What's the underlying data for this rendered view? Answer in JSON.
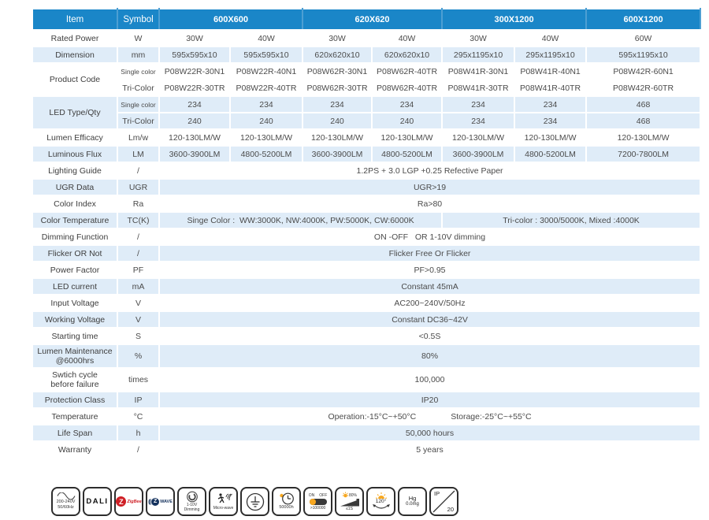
{
  "spec": {
    "header": {
      "item": "Item",
      "symbol": "Symbol",
      "sizes": [
        "600X600",
        "620X620",
        "300X1200",
        "600X1200"
      ]
    },
    "rated_power": {
      "label": "Rated Power",
      "unit": "W",
      "values": [
        "30W",
        "40W",
        "30W",
        "40W",
        "30W",
        "40W",
        "60W"
      ]
    },
    "dimension": {
      "label": "Dimension",
      "unit": "mm",
      "values": [
        "595x595x10",
        "595x595x10",
        "620x620x10",
        "620x620x10",
        "295x1195x10",
        "295x1195x10",
        "595x1195x10"
      ]
    },
    "product_code": {
      "label": "Product Code",
      "single_label": "Single color",
      "tri_label": "Tri-Color",
      "single": [
        "P08W22R-30N1",
        "P08W22R-40N1",
        "P08W62R-30N1",
        "P08W62R-40TR",
        "P08W41R-30N1",
        "P08W41R-40N1",
        "P08W42R-60N1"
      ],
      "tri": [
        "P08W22R-30TR",
        "P08W22R-40TR",
        "P08W62R-30TR",
        "P08W62R-40TR",
        "P08W41R-30TR",
        "P08W41R-40TR",
        "P08W42R-60TR"
      ]
    },
    "led_qty": {
      "label": "LED Type/Qty",
      "single_label": "Single color",
      "tri_label": "Tri-Color",
      "single": [
        "234",
        "234",
        "234",
        "234",
        "234",
        "234",
        "468"
      ],
      "tri": [
        "240",
        "240",
        "240",
        "240",
        "234",
        "234",
        "468"
      ]
    },
    "lumen_efficacy": {
      "label": "Lumen Efficacy",
      "unit": "Lm/w",
      "values": [
        "120-130LM/W",
        "120-130LM/W",
        "120-130LM/W",
        "120-130LM/W",
        "120-130LM/W",
        "120-130LM/W",
        "120-130LM/W"
      ]
    },
    "luminous_flux": {
      "label": "Luminous Flux",
      "unit": "LM",
      "values": [
        "3600-3900LM",
        "4800-5200LM",
        "3600-3900LM",
        "4800-5200LM",
        "3600-3900LM",
        "4800-5200LM",
        "7200-7800LM"
      ]
    },
    "lighting_guide": {
      "label": "Lighting Guide",
      "unit": "/",
      "value": "1.2PS + 3.0 LGP +0.25 Refective Paper"
    },
    "ugr": {
      "label": "UGR  Data",
      "unit": "UGR",
      "value": "UGR>19"
    },
    "color_index": {
      "label": "Color Index",
      "unit": "Ra",
      "value": "Ra>80"
    },
    "color_temp": {
      "label": "Color Temperature",
      "unit": "TC(K)",
      "single": "Singe Color :  WW:3000K, NW:4000K, PW:5000K, CW:6000K",
      "tri": "Tri-color : 3000/5000K, Mixed :4000K"
    },
    "dimming": {
      "label": "Dimming Function",
      "unit": "/",
      "value": "ON -OFF   OR 1-10V dimming"
    },
    "flicker": {
      "label": "Flicker OR Not",
      "unit": "/",
      "value": "Flicker Free Or Flicker"
    },
    "power_factor": {
      "label": "Power Factor",
      "unit": "PF",
      "value": "PF>0.95"
    },
    "led_current": {
      "label": "LED current",
      "unit": "mA",
      "value": "Constant 45mA"
    },
    "input_voltage": {
      "label": "Input Voltage",
      "unit": "V",
      "value": "AC200~240V/50Hz"
    },
    "working_voltage": {
      "label": "Working Voltage",
      "unit": "V",
      "value": "Constant DC36~42V"
    },
    "starting_time": {
      "label": "Starting time",
      "unit": "S",
      "value": "<0.5S"
    },
    "lumen_maintenance": {
      "label1": "Lumen Maintenance",
      "label2": "@6000hrs",
      "unit": "%",
      "value": "80%"
    },
    "switch_cycle": {
      "label1": "Swtich cycle",
      "label2": "before failure",
      "unit": "times",
      "value": "100,000"
    },
    "protection": {
      "label": "Protection Class",
      "unit": "IP",
      "value": "IP20"
    },
    "temperature": {
      "label": "Temperature",
      "unit": "°C",
      "operation": "Operation:-15°C~+50°C",
      "storage": "Storage:-25°C~+55°C"
    },
    "life_span": {
      "label": "Life Span",
      "unit": "h",
      "value": "50,000 hours"
    },
    "warranty": {
      "label": "Warranty",
      "unit": "/",
      "value": "5 years"
    }
  },
  "icons": {
    "voltage_line1": "200-240V",
    "voltage_line2": "50/60Hz",
    "dali": "DALI",
    "zigbee_z": "Z",
    "zigbee": "ZigBee",
    "zwave_wave": "((",
    "zwave_z": "Z",
    "zwave_text": "WAVE",
    "dimming_line1": "1-10V",
    "dimming_line2": "Dimming",
    "microwave": "Micro-wave",
    "lifespan": "50000h",
    "switch_on": "ON",
    "switch_off": "OFF",
    "switch_cycles": ">100000",
    "start_pct": "80%",
    "start_time": "≤1S",
    "beam_angle": "120°",
    "hg_line1": "Hg",
    "hg_line2": "0.0mg",
    "ip_line1": "IP",
    "ip_line2": "20"
  },
  "colors": {
    "header_blue": "#1a86c8",
    "stripe_blue": "#dfecf8",
    "accent_orange": "#f7a71f",
    "zigbee_red": "#cf1f25",
    "zwave_navy": "#16335e"
  }
}
